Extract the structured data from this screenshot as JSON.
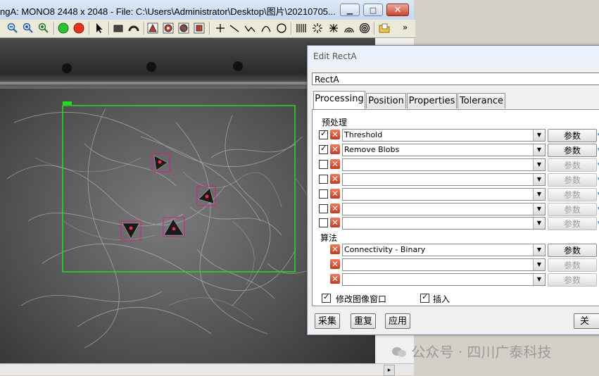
{
  "window": {
    "title": "ngA: MONO8 2448 x 2048 - File: C:\\Users\\Administrator\\Desktop\\图片\\20210705...",
    "minimize": "▁",
    "maximize": "□",
    "close": "✕"
  },
  "colors": {
    "roi": "#22dd22",
    "marker": "#cc2288",
    "cancel_red": "#d9472a"
  },
  "toolbar": {
    "icons": [
      "zoom-out-icon",
      "zoom-in-icon",
      "zoom-fit-icon",
      "green-circle-icon",
      "red-circle-icon",
      "pointer-icon",
      "rectangle-icon",
      "arc-icon",
      "shape1-icon",
      "shape2-icon",
      "shape3-icon",
      "shape4-icon",
      "crosshair-icon",
      "line-icon",
      "polyline-icon",
      "curve-icon",
      "circle-icon",
      "stripes-icon",
      "burst-icon",
      "star-icon",
      "arch-icon",
      "target-icon",
      "folder-icon"
    ],
    "overflow": "»"
  },
  "dialog": {
    "title": "Edit RectA",
    "name_value": "RectA",
    "tabs": [
      "Processing",
      "Position",
      "Properties",
      "Tolerance"
    ],
    "preprocess_label": "预处理",
    "algorithm_label": "算法",
    "param_label": "参数",
    "preprocess_rows": [
      {
        "checked": true,
        "value": "Threshold",
        "enabled": true
      },
      {
        "checked": true,
        "value": "Remove Blobs",
        "enabled": true
      },
      {
        "checked": false,
        "value": "",
        "enabled": false
      },
      {
        "checked": false,
        "value": "",
        "enabled": false
      },
      {
        "checked": false,
        "value": "",
        "enabled": false
      },
      {
        "checked": false,
        "value": "",
        "enabled": false
      },
      {
        "checked": false,
        "value": "",
        "enabled": false
      }
    ],
    "algorithm_rows": [
      {
        "value": "Connectivity - Binary",
        "enabled": true
      },
      {
        "value": "",
        "enabled": false
      },
      {
        "value": "",
        "enabled": false
      }
    ],
    "modify_window_label": "修改图像窗口",
    "insert_label": "插入",
    "modify_window_checked": true,
    "insert_checked": true,
    "buttons": {
      "acquire": "采集",
      "repeat": "重复",
      "apply": "应用",
      "close": "关"
    }
  },
  "watermark": "公众号 · 四川广泰科技"
}
